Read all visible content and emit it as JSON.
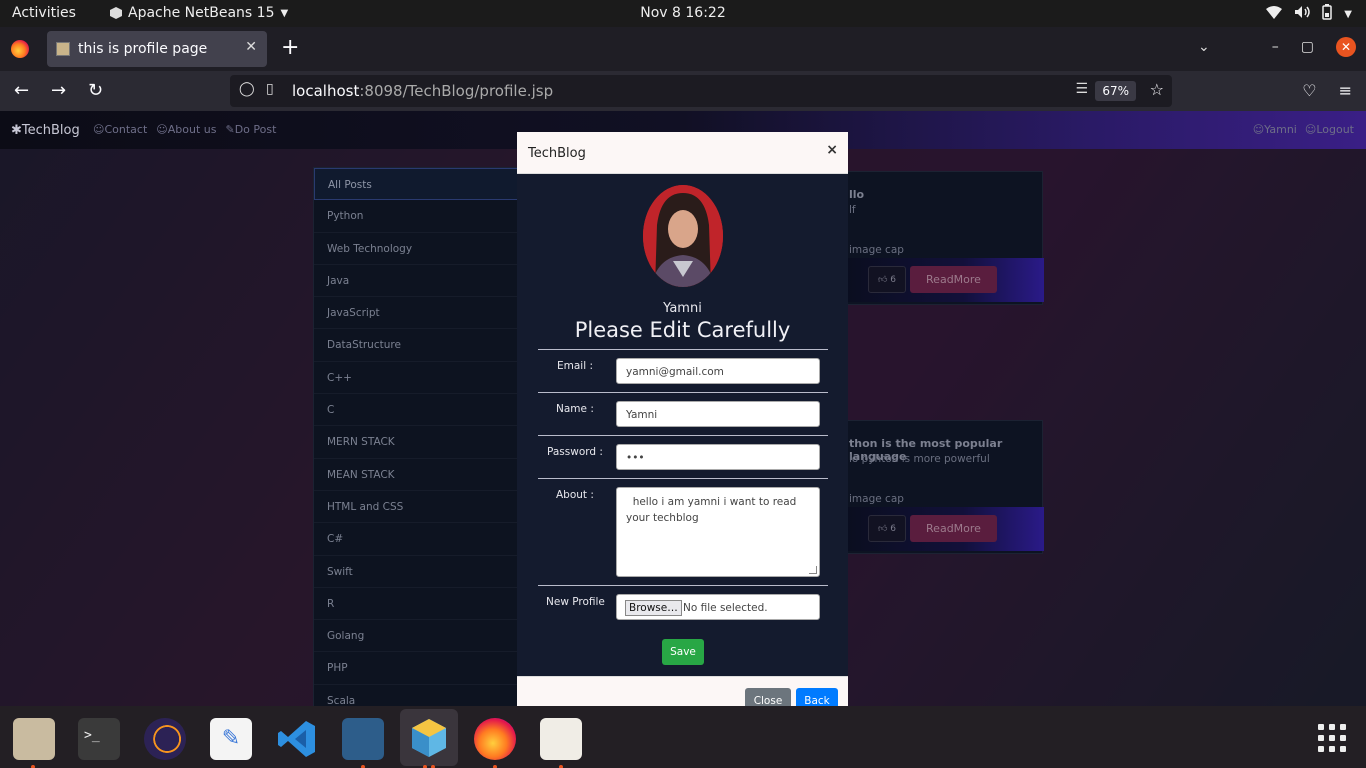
{
  "topbar": {
    "activities": "Activities",
    "app_name": "Apache NetBeans 15",
    "clock": "Nov 8  16:22"
  },
  "browser": {
    "tab_title": "this is profile page",
    "url_host": "localhost",
    "url_path": ":8098/TechBlog/profile.jsp",
    "zoom": "67%"
  },
  "site": {
    "brand": "✱TechBlog",
    "nav": [
      "Contact",
      "About us",
      "Do Post"
    ],
    "user": "Yamni",
    "logout": "Logout"
  },
  "categories": [
    "All Posts",
    "Python",
    "Web Technology",
    "Java",
    "JavaScript",
    "DataStructure",
    "C++",
    "C",
    "MERN STACK",
    "MEAN STACK",
    "HTML and CSS",
    "C#",
    "Swift",
    "R",
    "Golang",
    "PHP",
    "Scala"
  ],
  "posts": [
    {
      "title": "llo",
      "sub": "lf",
      "cap": "image cap",
      "likes": "6",
      "button": "ReadMore"
    },
    {
      "title": "thon is the most popular language",
      "sub": "lo pyhton is more powerful",
      "cap": "image cap",
      "likes": "6",
      "button": "ReadMore"
    }
  ],
  "modal": {
    "title": "TechBlog",
    "close_x": "×",
    "name": "Yamni",
    "heading": "Please Edit Carefully",
    "email_label": "Email :",
    "email_value": "yamni@gmail.com",
    "name_label": "Name :",
    "name_value": "Yamni",
    "password_label": "Password :",
    "password_value": "•••",
    "about_label": "About :",
    "about_value": "  hello i am yamni i want to read your techblog",
    "profile_label": "New Profile",
    "browse_label": "Browse…",
    "no_file": "No file selected.",
    "save": "Save",
    "close": "Close",
    "back": "Back"
  }
}
